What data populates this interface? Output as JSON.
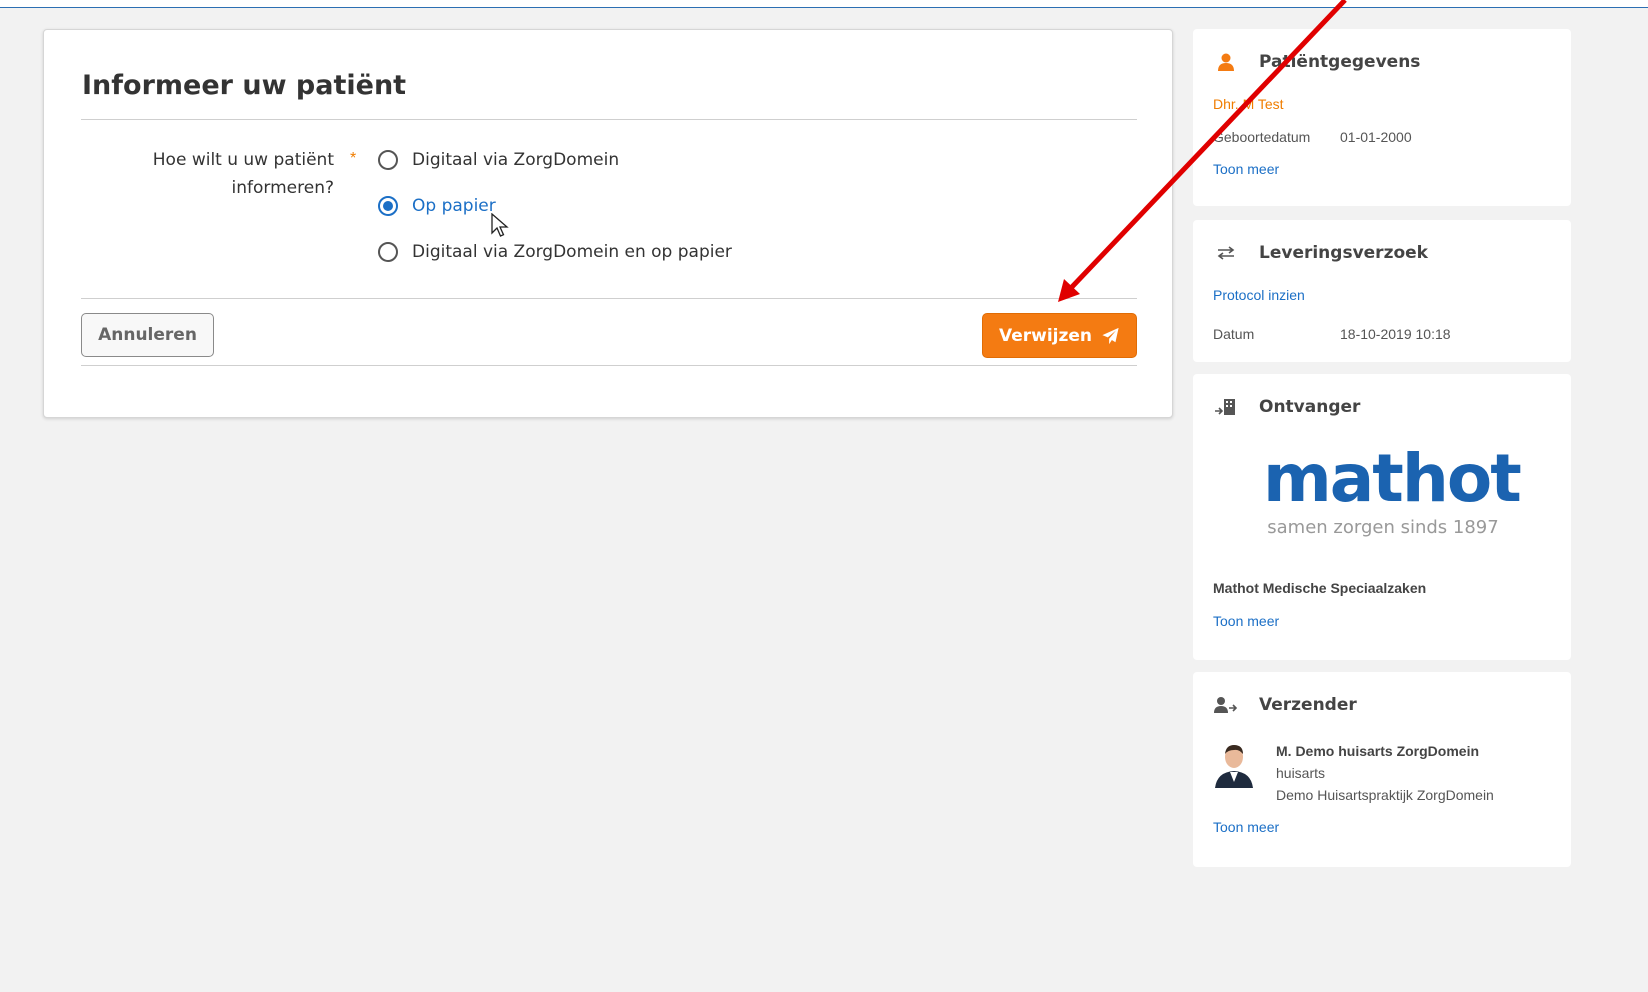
{
  "form": {
    "title": "Informeer uw patiënt",
    "question": "Hoe wilt u uw patiënt informeren?",
    "required_mark": "*",
    "options": [
      {
        "label": "Digitaal via ZorgDomein",
        "checked": false
      },
      {
        "label": "Op papier",
        "checked": true
      },
      {
        "label": "Digitaal via ZorgDomein en op papier",
        "checked": false
      }
    ],
    "cancel_label": "Annuleren",
    "submit_label": "Verwijzen"
  },
  "patient": {
    "title": "Patiëntgegevens",
    "name": "Dhr. M Test",
    "dob_label": "Geboortedatum",
    "dob_value": "01-01-2000",
    "more": "Toon meer"
  },
  "delivery": {
    "title": "Leveringsverzoek",
    "protocol_link": "Protocol inzien",
    "date_label": "Datum",
    "date_value": "18-10-2019 10:18"
  },
  "recipient": {
    "title": "Ontvanger",
    "logo_text": "mathot",
    "logo_tagline": "samen zorgen sinds 1897",
    "name": "Mathot Medische Speciaalzaken",
    "more": "Toon meer"
  },
  "sender": {
    "title": "Verzender",
    "name": "M. Demo huisarts ZorgDomein",
    "role": "huisarts",
    "practice": "Demo Huisartspraktijk ZorgDomein",
    "more": "Toon meer"
  },
  "colors": {
    "accent_blue": "#1b6fc6",
    "orange": "#f47b12",
    "annotation_arrow": "#e00000"
  }
}
